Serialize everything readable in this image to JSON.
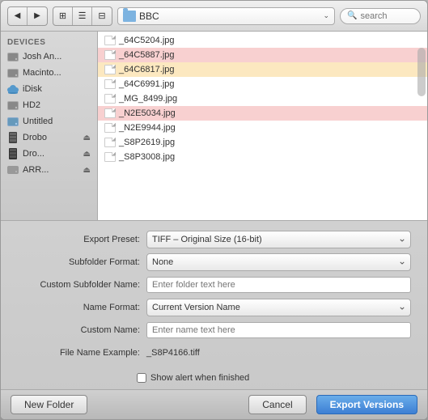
{
  "toolbar": {
    "back_label": "◀",
    "forward_label": "▶",
    "view_icon_label": "⊞",
    "view_list_label": "☰",
    "view_col_label": "⊟",
    "location": "BBC",
    "search_placeholder": "search"
  },
  "sidebar": {
    "section_label": "DEVICES",
    "items": [
      {
        "id": "josh",
        "label": "Josh An...",
        "icon": "hd"
      },
      {
        "id": "macinto",
        "label": "Macinto...",
        "icon": "hd"
      },
      {
        "id": "idisk",
        "label": "iDisk",
        "icon": "idisk"
      },
      {
        "id": "hd2",
        "label": "HD2",
        "icon": "hd"
      },
      {
        "id": "untitled",
        "label": "Untitled",
        "icon": "hd"
      },
      {
        "id": "drobo",
        "label": "Drobo",
        "icon": "drobo",
        "eject": true
      },
      {
        "id": "dro2",
        "label": "Dro...",
        "icon": "drobo",
        "eject": true
      },
      {
        "id": "arr",
        "label": "ARR...",
        "icon": "drive",
        "eject": true
      }
    ]
  },
  "filelist": {
    "files": [
      {
        "name": "_64C5204.jpg",
        "style": "normal"
      },
      {
        "name": "_64C5887.jpg",
        "style": "pink"
      },
      {
        "name": "_64C6817.jpg",
        "style": "orange"
      },
      {
        "name": "_64C6991.jpg",
        "style": "normal"
      },
      {
        "name": "_MG_8499.jpg",
        "style": "normal"
      },
      {
        "name": "_N2E5034.jpg",
        "style": "pink"
      },
      {
        "name": "_N2E9944.jpg",
        "style": "normal"
      },
      {
        "name": "_S8P2619.jpg",
        "style": "normal"
      },
      {
        "name": "_S8P3008.jpg",
        "style": "normal"
      }
    ]
  },
  "export_form": {
    "export_preset_label": "Export Preset:",
    "export_preset_value": "TIFF – Original Size (16-bit)",
    "subfolder_format_label": "Subfolder Format:",
    "subfolder_format_value": "None",
    "custom_subfolder_label": "Custom Subfolder Name:",
    "custom_subfolder_placeholder": "Enter folder text here",
    "name_format_label": "Name Format:",
    "name_format_value": "Current Version Name",
    "custom_name_label": "Custom Name:",
    "custom_name_placeholder": "Enter name text here",
    "filename_example_label": "File Name Example:",
    "filename_example_value": "_S8P4166.tiff",
    "show_alert_label": "Show alert when finished"
  },
  "buttons": {
    "new_folder": "New Folder",
    "cancel": "Cancel",
    "export_versions": "Export Versions"
  }
}
